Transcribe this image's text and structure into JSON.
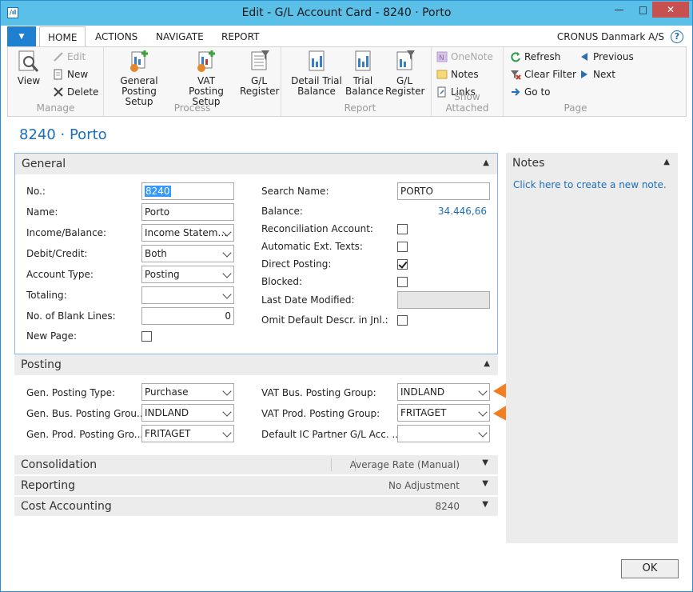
{
  "window": {
    "title": "Edit - G/L Account Card - 8240 · Porto",
    "minimize": "—",
    "maximize": "□",
    "close": "✕"
  },
  "tabs": {
    "app_menu": "▼",
    "items": [
      "HOME",
      "ACTIONS",
      "NAVIGATE",
      "REPORT"
    ],
    "company": "CRONUS Danmark A/S",
    "help": "?"
  },
  "ribbon": {
    "manage": {
      "label": "Manage",
      "view": "View",
      "edit": "Edit",
      "new": "New",
      "delete": "Delete"
    },
    "process": {
      "label": "Process",
      "general_posting_setup": [
        "General",
        "Posting Setup"
      ],
      "vat_posting_setup": [
        "VAT",
        "Posting Setup"
      ],
      "gl_register": [
        "G/L",
        "Register"
      ]
    },
    "report": {
      "label": "Report",
      "detail_trial_balance": [
        "Detail Trial",
        "Balance"
      ],
      "trial_balance": [
        "Trial",
        "Balance"
      ],
      "gl_register": [
        "G/L",
        "Register"
      ]
    },
    "show_attached": {
      "label": "Show Attached",
      "onenote": "OneNote",
      "notes": "Notes",
      "links": "Links"
    },
    "page": {
      "label": "Page",
      "refresh": "Refresh",
      "clear_filter": "Clear Filter",
      "go_to": "Go to",
      "previous": "Previous",
      "next": "Next"
    }
  },
  "page_title": "8240 · Porto",
  "general": {
    "header": "General",
    "no_label": "No.:",
    "no_value": "8240",
    "name_label": "Name:",
    "name_value": "Porto",
    "income_balance_label": "Income/Balance:",
    "income_balance_value": "Income Statem…",
    "debit_credit_label": "Debit/Credit:",
    "debit_credit_value": "Both",
    "account_type_label": "Account Type:",
    "account_type_value": "Posting",
    "totaling_label": "Totaling:",
    "totaling_value": "",
    "blank_lines_label": "No. of Blank Lines:",
    "blank_lines_value": "0",
    "new_page_label": "New Page:",
    "new_page_checked": false,
    "search_name_label": "Search Name:",
    "search_name_value": "PORTO",
    "balance_label": "Balance:",
    "balance_value": "34.446,66",
    "reconciliation_label": "Reconciliation Account:",
    "reconciliation_checked": false,
    "auto_ext_texts_label": "Automatic Ext. Texts:",
    "auto_ext_texts_checked": false,
    "direct_posting_label": "Direct Posting:",
    "direct_posting_checked": true,
    "blocked_label": "Blocked:",
    "blocked_checked": false,
    "last_modified_label": "Last Date Modified:",
    "last_modified_value": "",
    "omit_descr_label": "Omit Default Descr. in Jnl.:",
    "omit_descr_checked": false
  },
  "posting": {
    "header": "Posting",
    "gen_posting_type_label": "Gen. Posting Type:",
    "gen_posting_type_value": "Purchase",
    "gen_bus_label": "Gen. Bus. Posting Grou...",
    "gen_bus_value": "INDLAND",
    "gen_prod_label": "Gen. Prod. Posting Gro...",
    "gen_prod_value": "FRITAGET",
    "vat_bus_label": "VAT Bus. Posting Group:",
    "vat_bus_value": "INDLAND",
    "vat_prod_label": "VAT Prod. Posting Group:",
    "vat_prod_value": "FRITAGET",
    "default_ic_label": "Default IC Partner G/L Acc. ...",
    "default_ic_value": ""
  },
  "consolidation": {
    "label": "Consolidation",
    "summary": "Average Rate (Manual)"
  },
  "reporting": {
    "label": "Reporting",
    "summary": "No Adjustment"
  },
  "cost_accounting": {
    "label": "Cost Accounting",
    "summary": "8240"
  },
  "notes": {
    "header": "Notes",
    "link": "Click here to create a new note."
  },
  "ok_button": "OK",
  "colors": {
    "titlebar": "#5ac0e8",
    "accent_blue": "#1b6fb8",
    "arrow_orange": "#f07a1a"
  }
}
